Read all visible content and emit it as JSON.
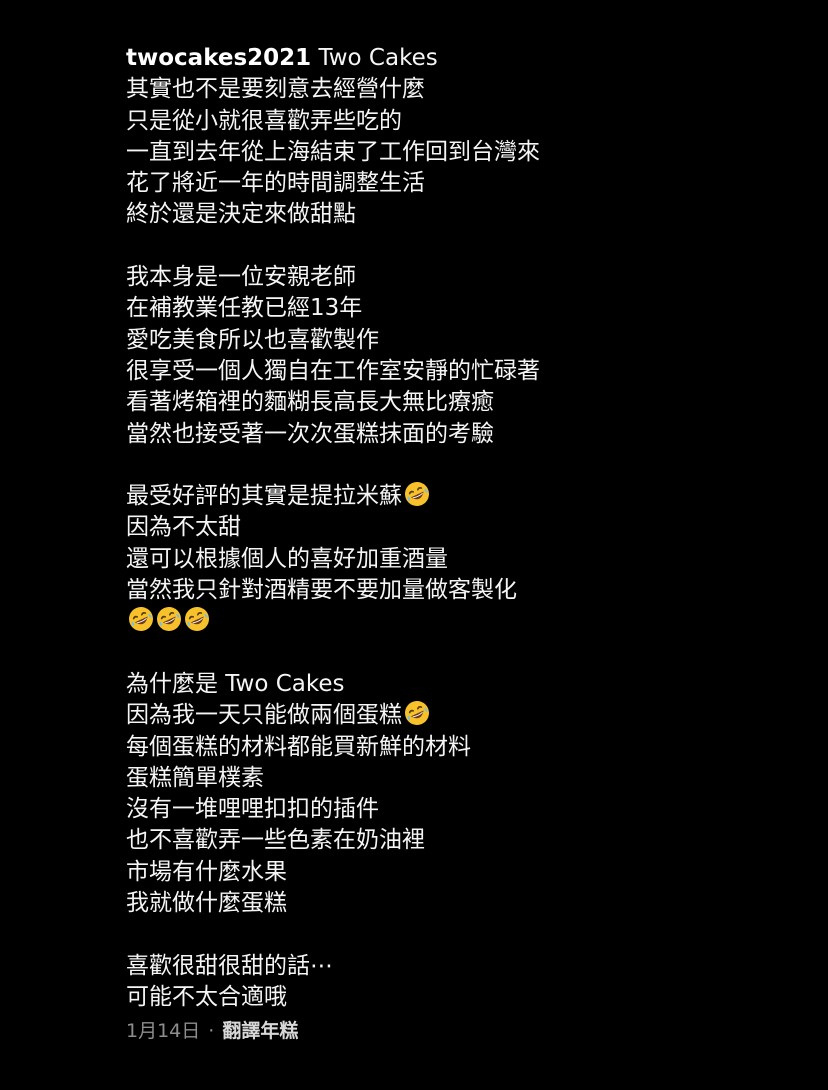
{
  "post": {
    "username": "twocakes2021",
    "lines": [
      {
        "text": "Two Cakes",
        "emoji_count": 0,
        "with_username": true
      },
      {
        "text": "其實也不是要刻意去經營什麼",
        "emoji_count": 0
      },
      {
        "text": "只是從小就很喜歡弄些吃的",
        "emoji_count": 0
      },
      {
        "text": "一直到去年從上海結束了工作回到台灣來",
        "emoji_count": 0
      },
      {
        "text": "花了將近一年的時間調整生活",
        "emoji_count": 0
      },
      {
        "text": "終於還是決定來做甜點",
        "emoji_count": 0
      },
      {
        "text": "",
        "emoji_count": 0
      },
      {
        "text": "我本身是一位安親老師",
        "emoji_count": 0
      },
      {
        "text": "在補教業任教已經13年",
        "emoji_count": 0
      },
      {
        "text": "愛吃美食所以也喜歡製作",
        "emoji_count": 0
      },
      {
        "text": "很享受一個人獨自在工作室安靜的忙碌著",
        "emoji_count": 0
      },
      {
        "text": "看著烤箱裡的麵糊長高長大無比療癒",
        "emoji_count": 0
      },
      {
        "text": "當然也接受著一次次蛋糕抹面的考驗",
        "emoji_count": 0
      },
      {
        "text": "",
        "emoji_count": 0
      },
      {
        "text": "最受好評的其實是提拉米蘇",
        "emoji_count": 1
      },
      {
        "text": "因為不太甜",
        "emoji_count": 0
      },
      {
        "text": "還可以根據個人的喜好加重酒量",
        "emoji_count": 0
      },
      {
        "text": "當然我只針對酒精要不要加量做客製化",
        "emoji_count": 0
      },
      {
        "text": "",
        "emoji_count": 3
      },
      {
        "text": "",
        "emoji_count": 0
      },
      {
        "text": "為什麼是 Two Cakes",
        "emoji_count": 0
      },
      {
        "text": "因為我一天只能做兩個蛋糕",
        "emoji_count": 1
      },
      {
        "text": "每個蛋糕的材料都能買新鮮的材料",
        "emoji_count": 0
      },
      {
        "text": "蛋糕簡單樸素",
        "emoji_count": 0
      },
      {
        "text": "沒有一堆哩哩扣扣的插件",
        "emoji_count": 0
      },
      {
        "text": "也不喜歡弄一些色素在奶油裡",
        "emoji_count": 0
      },
      {
        "text": "市場有什麼水果",
        "emoji_count": 0
      },
      {
        "text": "我就做什麼蛋糕",
        "emoji_count": 0
      },
      {
        "text": "",
        "emoji_count": 0
      },
      {
        "text": "喜歡很甜很甜的話⋯",
        "emoji_count": 0
      },
      {
        "text": "可能不太合適哦",
        "emoji_count": 0
      }
    ],
    "emoji_icon": "rolling-on-floor-laughing-icon",
    "date": "1月14日",
    "separator": "·",
    "translate_label": "翻譯年糕"
  },
  "colors": {
    "background": "#000000",
    "text": "#f5f5f5",
    "secondary": "#8e8e8e",
    "emoji_face": "#f7c12b"
  }
}
